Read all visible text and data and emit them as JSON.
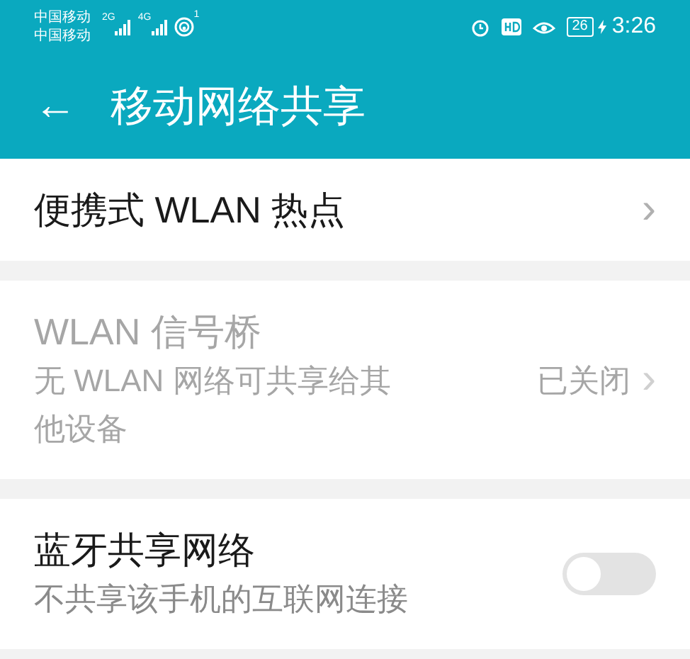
{
  "status_bar": {
    "carriers": [
      "中国移动",
      "中国移动"
    ],
    "network_2g": "2G",
    "network_4g": "4G",
    "hotspot_count": "1",
    "battery": "26",
    "charging": true,
    "time": "3:26"
  },
  "header": {
    "back": "←",
    "title": "移动网络共享"
  },
  "sections": [
    {
      "kind": "link",
      "title": "便携式 WLAN 热点",
      "disabled": false,
      "chevron": "›"
    },
    {
      "kind": "link",
      "title": "WLAN 信号桥",
      "subtitle": "无 WLAN 网络可共享给其他设备",
      "value": "已关闭",
      "disabled": true,
      "chevron": "›"
    },
    {
      "kind": "switch",
      "title": "蓝牙共享网络",
      "subtitle": "不共享该手机的互联网连接",
      "disabled": false,
      "on": false
    }
  ]
}
